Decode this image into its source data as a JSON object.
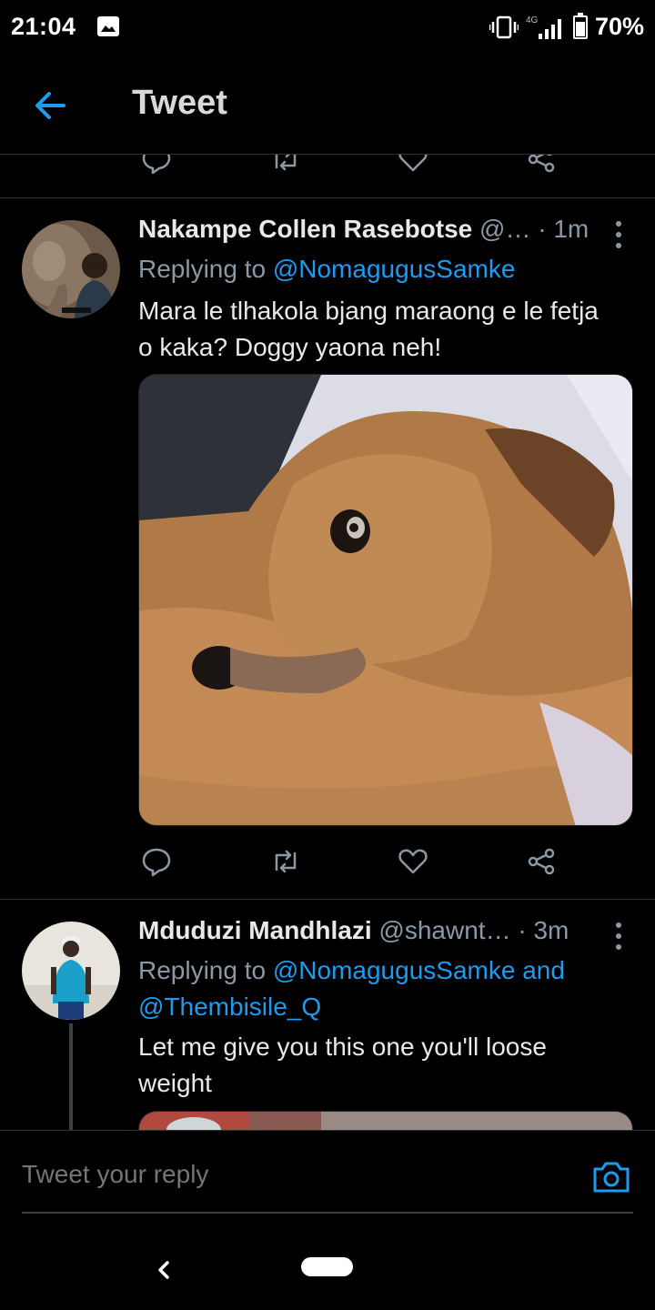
{
  "status_bar": {
    "time": "21:04",
    "network": "4G",
    "battery": "70%",
    "battery_level": 0.7,
    "icons": [
      "gallery-icon",
      "vibrate-icon",
      "signal-icon",
      "battery-icon"
    ]
  },
  "header": {
    "title": "Tweet",
    "back_icon": "arrow-left-icon"
  },
  "tweets": [
    {
      "name": "Nakampe Collen Rasebotse",
      "handle": "@…",
      "time": "· 1m",
      "replying_prefix": "Replying to",
      "mentions": "@NomagugusSamke",
      "text_line1": "Mara le tlhakola bjang maraong e le fetja",
      "text_line2": "o kaka? Doggy yaona neh!",
      "media": "photo"
    },
    {
      "name": "Mduduzi Mandhlazi",
      "handle": "@shawnt…",
      "time": "· 3m",
      "replying_prefix": "Replying to",
      "mentions_line1": "@NomagugusSamke and",
      "mentions_line2": "@Thembisile_Q",
      "text_line1": "Let me give you this one you'll loose",
      "text_line2": "weight",
      "media": "photo"
    }
  ],
  "actions": [
    "reply-icon",
    "retweet-icon",
    "like-icon",
    "share-icon"
  ],
  "reply_bar": {
    "placeholder": "Tweet your reply",
    "camera_icon": "camera-icon"
  },
  "nav": {
    "back_icon": "nav-back-icon",
    "home_icon": "home-pill-icon"
  },
  "colors": {
    "accent": "#1d9bf0",
    "background": "#000000",
    "secondary_text": "#8b98a5"
  }
}
